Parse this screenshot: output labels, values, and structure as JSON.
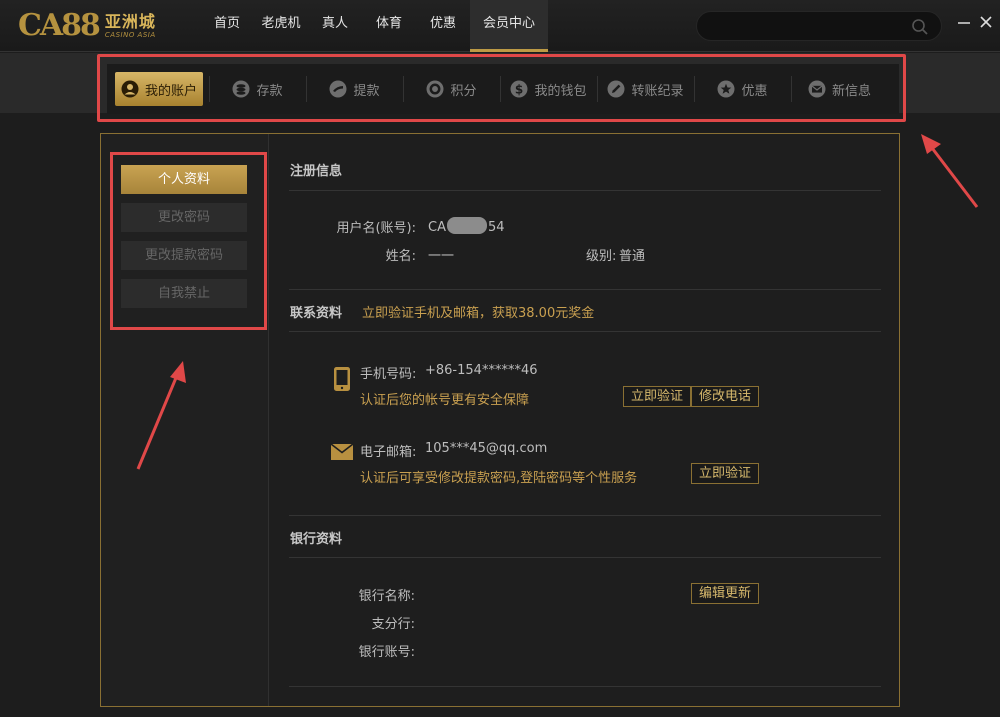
{
  "logo": {
    "mark": "CA88",
    "cn": "亚洲城",
    "en": "CASINO ASIA"
  },
  "nav": [
    "首页",
    "老虎机",
    "真人",
    "体育",
    "优惠",
    "会员中心"
  ],
  "nav_active": "会员中心",
  "search": {
    "placeholder": ""
  },
  "tabs": [
    {
      "label": "我的账户",
      "icon": "user-icon"
    },
    {
      "label": "存款",
      "icon": "coins-icon"
    },
    {
      "label": "提款",
      "icon": "withdraw-icon"
    },
    {
      "label": "积分",
      "icon": "chip-icon"
    },
    {
      "label": "我的钱包",
      "icon": "dollar-icon"
    },
    {
      "label": "转账纪录",
      "icon": "pencil-icon"
    },
    {
      "label": "优惠",
      "icon": "star-icon"
    },
    {
      "label": "新信息",
      "icon": "envelope-icon"
    }
  ],
  "sidebar": [
    "个人资料",
    "更改密码",
    "更改提款密码",
    "自我禁止"
  ],
  "register": {
    "title": "注册信息",
    "username_label": "用户名(账号):",
    "username_prefix": "CA",
    "username_suffix": "54",
    "name_label": "姓名:",
    "name_value": "一一",
    "level_label": "级别:",
    "level_value": "普通"
  },
  "contact": {
    "title": "联系资料",
    "promo": "立即验证手机及邮箱，获取38.00元奖金",
    "phone_label": "手机号码:",
    "phone_value": "+86-154******46",
    "phone_note": "认证后您的帐号更有安全保障",
    "verify_btn": "立即验证",
    "edit_phone_btn": "修改电话",
    "email_label": "电子邮箱:",
    "email_value": "105***45@qq.com",
    "email_note": "认证后可享受修改提款密码,登陆密码等个性服务",
    "email_verify_btn": "立即验证"
  },
  "bank": {
    "title": "银行资料",
    "bank_name_label": "银行名称:",
    "branch_label": "支分行:",
    "account_label": "银行账号:",
    "edit_btn": "编辑更新"
  },
  "colors": {
    "gold": "#bd9a45",
    "annotation": "#e04848"
  }
}
